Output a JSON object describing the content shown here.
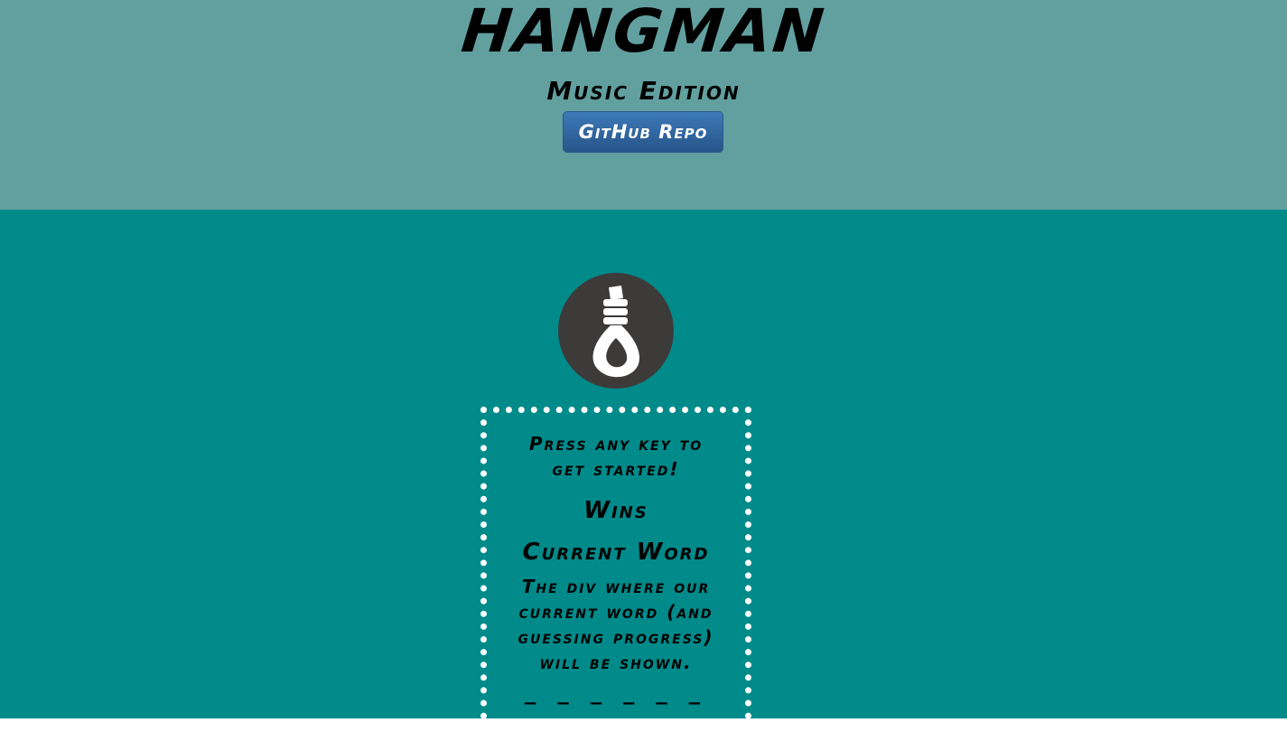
{
  "header": {
    "title": "HANGMAN",
    "subtitle": "Music Edition",
    "repo_button_label": "GitHub Repo",
    "background_color": "#62a0a0"
  },
  "logo": {
    "icon": "noose-icon",
    "background_color": "#3d3a3a"
  },
  "game": {
    "instructions": "Press any key to get started!",
    "wins_label": "Wins",
    "current_word_label": "Current Word",
    "word_description": "The div where our current word (and guessing progress) will be shown.",
    "word_blanks": "_ _ _ _ _ _",
    "background_color": "#008a8a",
    "border_color": "#ffffff"
  }
}
